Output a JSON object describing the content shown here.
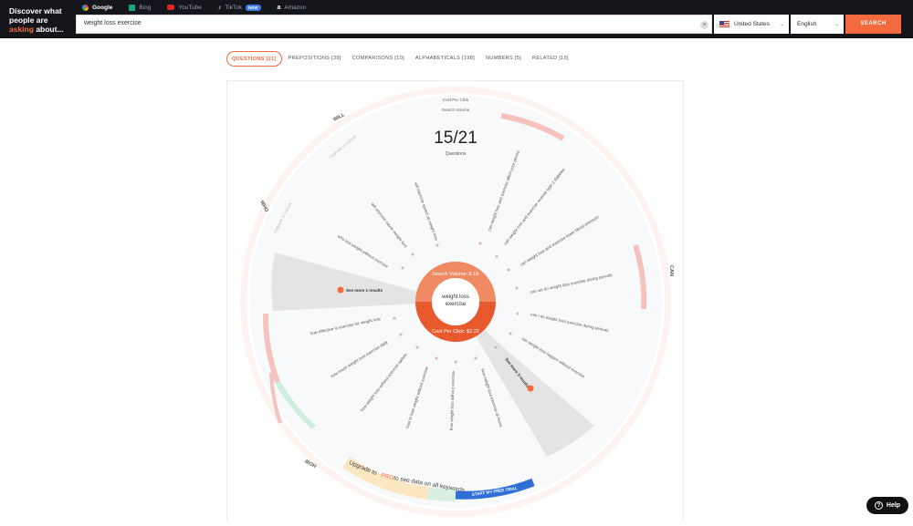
{
  "brand": {
    "line1": "Discover what",
    "line2": "people are",
    "asking": "asking",
    "line3": "about..."
  },
  "engines": [
    {
      "label": "Google",
      "icon": "google-icon",
      "color": "#ea4335",
      "active": true
    },
    {
      "label": "Bing",
      "icon": "bing-icon",
      "color": "#18a689",
      "active": false
    },
    {
      "label": "YouTube",
      "icon": "youtube-icon",
      "color": "#e02424",
      "active": false
    },
    {
      "label": "TikTok",
      "icon": "tiktok-icon",
      "color": "#ffffff",
      "active": false,
      "badge": "NEW"
    },
    {
      "label": "Amazon",
      "icon": "amazon-icon",
      "color": "#ffffff",
      "active": false
    }
  ],
  "search": {
    "value": "weight loss exercise",
    "clear_symbol": "×"
  },
  "country": {
    "label": "United States"
  },
  "language": {
    "label": "English"
  },
  "search_button": "SEARCH",
  "tabs": [
    {
      "label": "QUESTIONS [21]",
      "active": true
    },
    {
      "label": "PREPOSITIONS [39]",
      "active": false
    },
    {
      "label": "COMPARISONS [10]",
      "active": false
    },
    {
      "label": "ALPHABETICALS [198]",
      "active": false
    },
    {
      "label": "NUMBERS [5]",
      "active": false
    },
    {
      "label": "RELATED [15]",
      "active": false
    }
  ],
  "wheel": {
    "legend_cpc": "Cost Per Click",
    "legend_volume": "Search Volume",
    "count": "15/21",
    "count_label": "Questions",
    "center_term_1": "weight loss",
    "center_term_2": "exercise",
    "search_volume": "Search Volume: 8.1K",
    "cpc": "Cost Per Click: $2.22",
    "group_labels": [
      "WILL",
      "WHO",
      "CAN",
      "HOW"
    ],
    "see_more_left": "See more 1 results",
    "see_more_right": "See more 3 results",
    "faded_will": "Upgrade to Unlock",
    "faded_who": "Upgrade to Unlock",
    "upgrade_text_1": "Upgrade to",
    "upgrade_pro": "PRO",
    "upgrade_text_2": "to see data on all keywords",
    "trial_button": "START MY FREE TRIAL",
    "questions_right": [
      "can weight loss and exercise affect your period",
      "can weight loss and exercise reverse type 2 diabetes",
      "can weight loss and exercise lower blood pressure",
      "can we do weight loss exercise during periods",
      "can i do weight loss exercise during periods",
      "can weight loss happen without exercise"
    ],
    "questions_left_top": [
      "will exercise speed up weight loss",
      "will exercise cause weight loss",
      "who lost weight without exercise"
    ],
    "questions_left_bottom": [
      "how effective is exercise for weight loss",
      "how much weight loss exercise daily",
      "how weight loss without exercise tablets",
      "how to lose weight without exercise",
      "how weight loss without exercise",
      "how weight loss exercise at home"
    ]
  },
  "help_label": "Help",
  "colors": {
    "accent": "#f26a3d",
    "dark_bar": "#14161c",
    "ring_pink": "#fbe0da",
    "trial_blue": "#2f6fd6"
  }
}
